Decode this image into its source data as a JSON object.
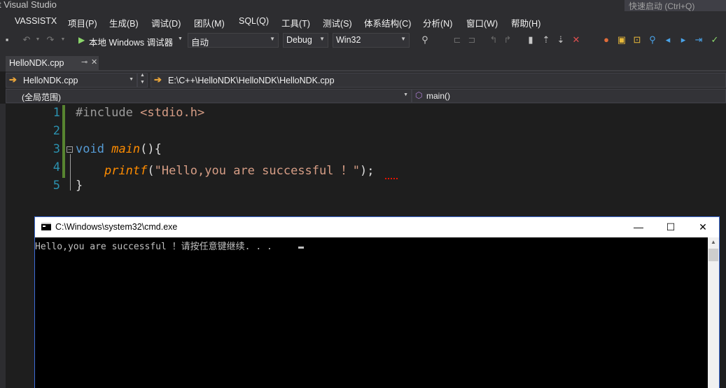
{
  "window": {
    "title": "t Visual Studio",
    "quick_launch_placeholder": "快速启动 (Ctrl+Q)"
  },
  "menu": [
    "VASSISTX",
    "项目(P)",
    "生成(B)",
    "调试(D)",
    "团队(M)",
    "SQL(Q)",
    "工具(T)",
    "测试(S)",
    "体系结构(C)",
    "分析(N)",
    "窗口(W)",
    "帮助(H)"
  ],
  "toolbar": {
    "run_label": "本地 Windows 调试器",
    "run_mode": "自动",
    "configuration": "Debug",
    "platform": "Win32"
  },
  "tabs": [
    {
      "label": "HelloNDK.cpp"
    }
  ],
  "nav": {
    "file_selector": "HelloNDK.cpp",
    "path": "E:\\C++\\HelloNDK\\HelloNDK\\HelloNDK.cpp",
    "scope": "(全局范围)",
    "member": "main()"
  },
  "editor": {
    "lines": [
      {
        "number": "1",
        "text": "#include <stdio.h>"
      },
      {
        "number": "2",
        "text": ""
      },
      {
        "number": "3",
        "text": "void main(){"
      },
      {
        "number": "4",
        "text": "    printf(\"Hello,you are successful ！\");"
      },
      {
        "number": "5",
        "text": "}"
      }
    ],
    "tokens": {
      "l1_pp": "#include",
      "l1_inc": " <stdio.h>",
      "l3_kw": "void",
      "l3_fn": "main",
      "l3_rest": "(){",
      "l4_indent": "    ",
      "l4_fn": "printf",
      "l4_open": "(",
      "l4_str1": "\"Hello,you are successful ",
      "l4_err": "！",
      "l4_str2": "\"",
      "l4_close": ");",
      "l5": "}"
    }
  },
  "console": {
    "title": "C:\\Windows\\system32\\cmd.exe",
    "output": "Hello,you are successful ！请按任意键继续. . ."
  },
  "colors": {
    "vs_background": "#1e1e1e",
    "chrome": "#2d2d30",
    "keyword": "#569cd6",
    "string": "#d69d85",
    "function": "#dcdcaa",
    "line_number": "#2b91af",
    "change_bar": "#578430"
  }
}
